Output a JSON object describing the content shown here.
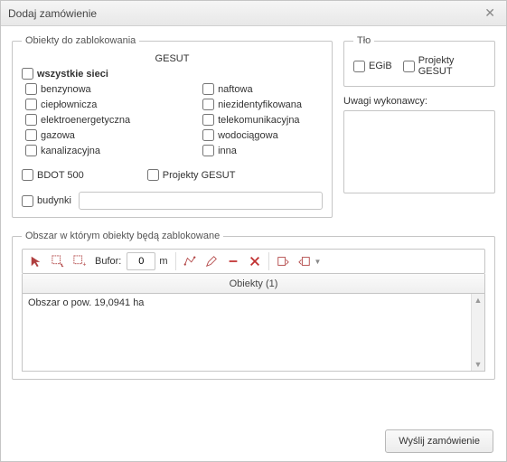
{
  "window": {
    "title": "Dodaj zamówienie"
  },
  "objects": {
    "legend": "Obiekty do zablokowania",
    "gesut_heading": "GESUT",
    "all_networks": "wszystkie sieci",
    "left": {
      "benzynowa": "benzynowa",
      "cieplownicza": "ciepłownicza",
      "ee": "elektroenergetyczna",
      "gazowa": "gazowa",
      "kanal": "kanalizacyjna"
    },
    "right": {
      "naftowa": "naftowa",
      "niezident": "niezidentyfikowana",
      "telekom": "telekomunikacyjna",
      "wodoc": "wodociągowa",
      "inna": "inna"
    },
    "bdot": "BDOT 500",
    "projekty": "Projekty GESUT",
    "budynki": "budynki",
    "budynki_value": ""
  },
  "background": {
    "legend": "Tło",
    "egib": "EGiB",
    "projekty": "Projekty GESUT"
  },
  "comments": {
    "label": "Uwagi wykonawcy:",
    "value": ""
  },
  "area": {
    "legend": "Obszar w którym obiekty będą zablokowane",
    "buffer_label": "Bufor:",
    "buffer_value": "0",
    "buffer_unit": "m",
    "header": "Obiekty (1)",
    "row": "Obszar o pow. 19,0941 ha"
  },
  "footer": {
    "submit": "Wyślij zamówienie"
  }
}
